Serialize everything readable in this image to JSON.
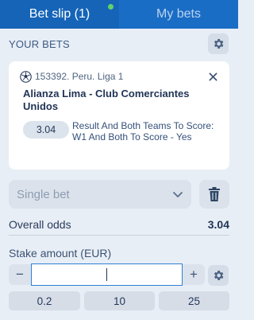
{
  "tabs": [
    {
      "label": "Bet slip (1)",
      "active": true,
      "notification_dot": true
    },
    {
      "label": "My bets",
      "active": false
    }
  ],
  "your_bets": {
    "title": "YOUR BETS",
    "settings_icon": "gear-icon"
  },
  "bet": {
    "sport_icon": "soccer-ball-icon",
    "league": "153392. Peru. Liga 1",
    "match": "Alianza Lima - Club Comerciantes Unidos",
    "odds": "3.04",
    "pick": "Result And Both Teams To Score: W1 And Both To Score - Yes",
    "remove_icon": "close-icon"
  },
  "bet_type": {
    "value": "Single bet",
    "icon": "chevron-down-icon",
    "delete_icon": "trash-icon"
  },
  "overall_odds": {
    "label": "Overall odds",
    "value": "3.04"
  },
  "stake": {
    "label": "Stake amount (EUR)",
    "value": "",
    "minus": "−",
    "plus": "+",
    "settings_icon": "gear-icon"
  },
  "quick_amounts": [
    "0.2",
    "10",
    "25"
  ],
  "colors": {
    "header": "#1a6dc5",
    "background": "#e8eef5",
    "accent": "#2d80d6",
    "dot": "#5fd36a"
  }
}
